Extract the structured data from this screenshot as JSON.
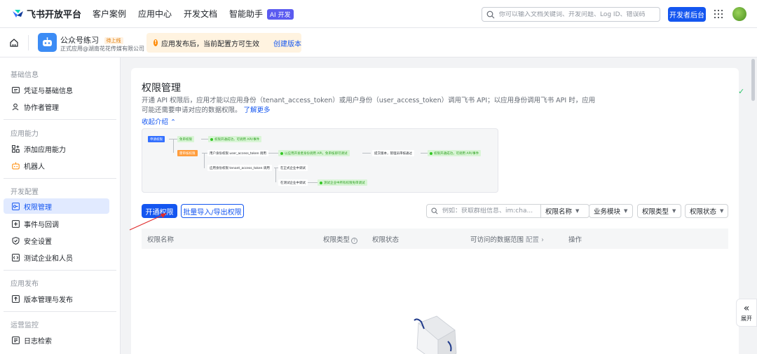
{
  "topnav": {
    "brand": "飞书开放平台",
    "items": [
      "客户案例",
      "应用中心",
      "开发文档"
    ],
    "assistant": "智能助手",
    "ai_badge": "AI 开发",
    "search_placeholder": "你可以输入文档关键词、开发问题、Log ID、错误码",
    "dev_console": "开发者后台"
  },
  "app": {
    "name": "公众号练习",
    "status_tag": "待上线",
    "subtitle": "正式应用@湖南花花传媒有限公司",
    "notice": "应用发布后，当前配置方可生效",
    "notice_link": "创建版本"
  },
  "sidebar": {
    "sections": [
      {
        "title": "基础信息",
        "items": [
          {
            "label": "凭证与基础信息",
            "icon": "id-card-icon"
          },
          {
            "label": "协作者管理",
            "icon": "user-icon"
          }
        ]
      },
      {
        "title": "应用能力",
        "items": [
          {
            "label": "添加应用能力",
            "icon": "add-grid-icon"
          },
          {
            "label": "机器人",
            "icon": "robot-icon"
          }
        ]
      },
      {
        "title": "开发配置",
        "items": [
          {
            "label": "权限管理",
            "icon": "key-icon"
          },
          {
            "label": "事件与回调",
            "icon": "event-icon"
          },
          {
            "label": "安全设置",
            "icon": "shield-icon"
          },
          {
            "label": "测试企业和人员",
            "icon": "test-icon"
          }
        ]
      },
      {
        "title": "应用发布",
        "items": [
          {
            "label": "版本管理与发布",
            "icon": "upload-icon"
          }
        ]
      },
      {
        "title": "运营监控",
        "items": [
          {
            "label": "日志检索",
            "icon": "log-icon"
          }
        ]
      }
    ],
    "active": "权限管理"
  },
  "main": {
    "title": "权限管理",
    "description": "开通 API 权限后，应用才能以应用身份（tenant_access_token）或用户身份（user_access_token）调用飞书 API；以应用身份调用飞书 API 时，应用可能还需要申请对应的数据权限。",
    "learn_more": "了解更多",
    "collapse": "收起介绍",
    "diagram": {
      "start": "申请权限",
      "free": "免审权限",
      "free_result": "权限开通成功，可调用 API/事件",
      "review": "需审核权限",
      "user_identity": "用户身份权限 user_access_token 调用",
      "user_step": "以应用开发者身份调用 API，免审核即可调试",
      "submit": "提交版本，管理员审核通过",
      "user_result": "权限开通成功，可调用 API/事件",
      "app_identity": "应用身份权限 tenant_access_token 调用",
      "formal": "在正式企业中调试",
      "test": "在测试企业中调试",
      "test_step": "测试企业中所有权限免审调试"
    },
    "open_btn": "开通权限",
    "batch_btn": "批量导入/导出权限",
    "filter_placeholder": "例如：获取群组信息、im:cha...",
    "filters": [
      "权限名称",
      "业务模块",
      "权限类型",
      "权限状态"
    ],
    "columns": {
      "name": "权限名称",
      "type": "权限类型",
      "status": "权限状态",
      "scope": "可访问的数据范围",
      "config": "配置",
      "actions": "操作"
    }
  },
  "float": {
    "expand": "展开"
  },
  "colors": {
    "primary": "#1456f0",
    "active_bg": "#e1eaff",
    "notice_bg": "#fff3e0"
  }
}
